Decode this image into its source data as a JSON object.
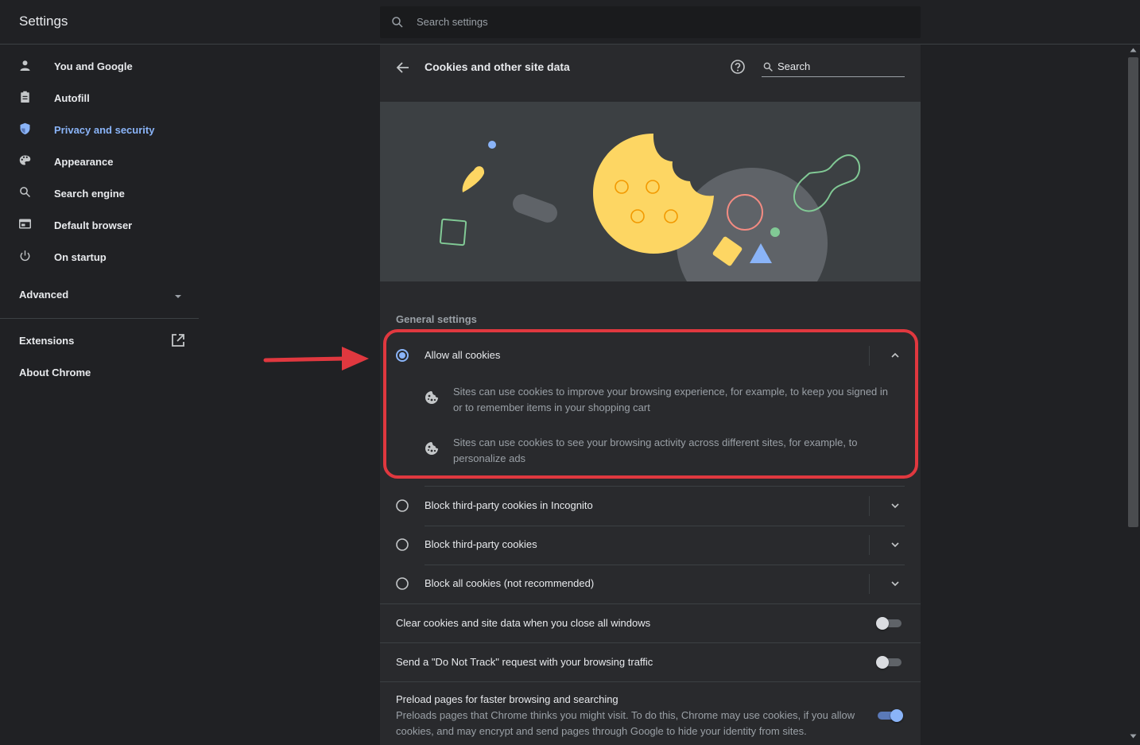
{
  "header": {
    "title": "Settings",
    "search_placeholder": "Search settings"
  },
  "sidebar": {
    "items": [
      {
        "label": "You and Google",
        "icon": "person-icon"
      },
      {
        "label": "Autofill",
        "icon": "clipboard-icon"
      },
      {
        "label": "Privacy and security",
        "icon": "shield-icon",
        "active": true
      },
      {
        "label": "Appearance",
        "icon": "palette-icon"
      },
      {
        "label": "Search engine",
        "icon": "search-icon"
      },
      {
        "label": "Default browser",
        "icon": "browser-icon"
      },
      {
        "label": "On startup",
        "icon": "power-icon"
      }
    ],
    "advanced": "Advanced",
    "extensions": "Extensions",
    "about": "About Chrome"
  },
  "main": {
    "title": "Cookies and other site data",
    "search_placeholder": "Search",
    "section_label": "General settings",
    "options": [
      {
        "label": "Allow all cookies",
        "selected": true,
        "expanded": true,
        "details": [
          "Sites can use cookies to improve your browsing experience, for example, to keep you signed in or to remember items in your shopping cart",
          "Sites can use cookies to see your browsing activity across different sites, for example, to personalize ads"
        ]
      },
      {
        "label": "Block third-party cookies in Incognito",
        "selected": false
      },
      {
        "label": "Block third-party cookies",
        "selected": false
      },
      {
        "label": "Block all cookies (not recommended)",
        "selected": false
      }
    ],
    "toggles": [
      {
        "label": "Clear cookies and site data when you close all windows",
        "on": false
      },
      {
        "label": "Send a \"Do Not Track\" request with your browsing traffic",
        "on": false
      }
    ],
    "preload": {
      "title": "Preload pages for faster browsing and searching",
      "description": "Preloads pages that Chrome thinks you might visit. To do this, Chrome may use cookies, if you allow cookies, and may encrypt and send pages through Google to hide your identity from sites.",
      "on": true
    }
  },
  "colors": {
    "accent": "#8ab4f8",
    "highlight": "#e0383f",
    "cookie": "#fdd663"
  }
}
